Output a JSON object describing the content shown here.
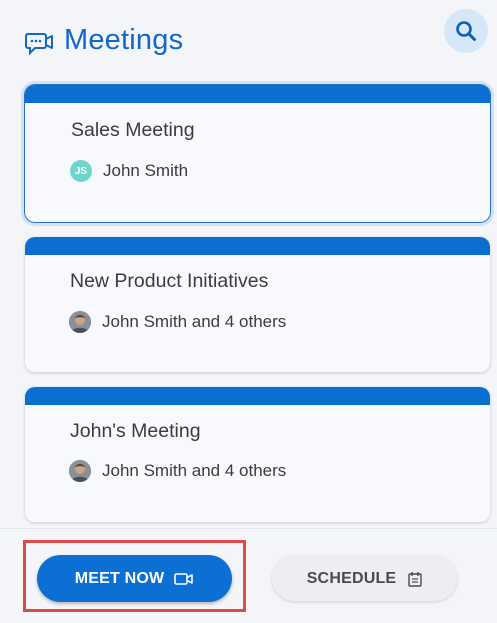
{
  "header": {
    "title": "Meetings",
    "title_icon": "video-chat-icon",
    "search_icon": "search-icon"
  },
  "meetings": [
    {
      "title": "Sales Meeting",
      "attendees": "John Smith",
      "avatar_initials": "JS",
      "selected": true
    },
    {
      "title": "New Product Initiatives",
      "attendees": "John Smith and 4 others",
      "avatar_initials": "",
      "selected": false
    },
    {
      "title": "John's Meeting",
      "attendees": "John Smith and 4 others",
      "avatar_initials": "",
      "selected": false
    }
  ],
  "footer": {
    "meet_now_label": "MEET NOW",
    "meet_now_icon": "video-camera-icon",
    "schedule_label": "SCHEDULE",
    "schedule_icon": "calendar-icon"
  },
  "colors": {
    "accent": "#0b6fd3",
    "card_bar": "#0a6fd1",
    "title": "#1168c8",
    "highlight": "#e04848"
  }
}
